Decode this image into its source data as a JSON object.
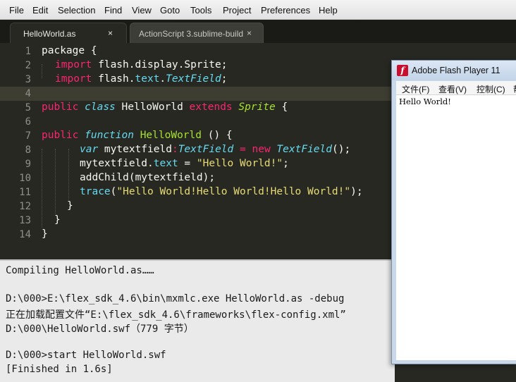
{
  "menu": [
    "File",
    "Edit",
    "Selection",
    "Find",
    "View",
    "Goto",
    "Tools",
    "Project",
    "Preferences",
    "Help"
  ],
  "tabs": [
    {
      "label": "HelloWorld.as",
      "close": "×"
    },
    {
      "label": "ActionScript 3.sublime-build",
      "close": "×"
    }
  ],
  "line_numbers": [
    "1",
    "2",
    "3",
    "4",
    "5",
    "6",
    "7",
    "8",
    "9",
    "10",
    "11",
    "12",
    "13",
    "14"
  ],
  "code": {
    "l1": [
      "package {"
    ],
    "l2": [
      "import",
      " flash.display.Sprite;"
    ],
    "l3": [
      "import",
      " flash.",
      "text",
      ".",
      "TextField",
      ";"
    ],
    "l5": [
      "public",
      " ",
      "class",
      " HelloWorld ",
      "extends",
      " ",
      "Sprite",
      " {"
    ],
    "l7": [
      "public",
      " ",
      "function",
      " ",
      "HelloWorld",
      " () {"
    ],
    "l8": [
      "var",
      " mytextfield",
      ":",
      "TextField",
      " ",
      "=",
      " ",
      "new",
      " ",
      "TextField",
      "();"
    ],
    "l9": [
      "mytextfield.",
      "text",
      " = ",
      "\"Hello World!\"",
      ";"
    ],
    "l10": [
      "addChild(mytextfield);"
    ],
    "l11": [
      "trace",
      "(",
      "\"Hello World!Hello World!Hello World!\"",
      ");"
    ],
    "l12": [
      "}"
    ],
    "l13": [
      "}"
    ],
    "l14": [
      "}"
    ]
  },
  "console": [
    "Compiling HelloWorld.as……",
    "",
    "D:\\000>E:\\flex_sdk_4.6\\bin\\mxmlc.exe HelloWorld.as -debug",
    "正在加载配置文件“E:\\flex_sdk_4.6\\frameworks\\flex-config.xml”",
    "D:\\000\\HelloWorld.swf（779 字节）",
    "",
    "D:\\000>start HelloWorld.swf",
    "[Finished in 1.6s]"
  ],
  "flash": {
    "icon_letter": "f",
    "title": "Adobe Flash Player 11",
    "menu": [
      "文件(F)",
      "查看(V)",
      "控制(C)",
      "帮"
    ],
    "output": "Hello World!"
  },
  "colors": {
    "editor_bg": "#272822",
    "keyword": "#f92672",
    "type": "#66d9ef",
    "function": "#a6e22e",
    "string": "#e6db74"
  }
}
